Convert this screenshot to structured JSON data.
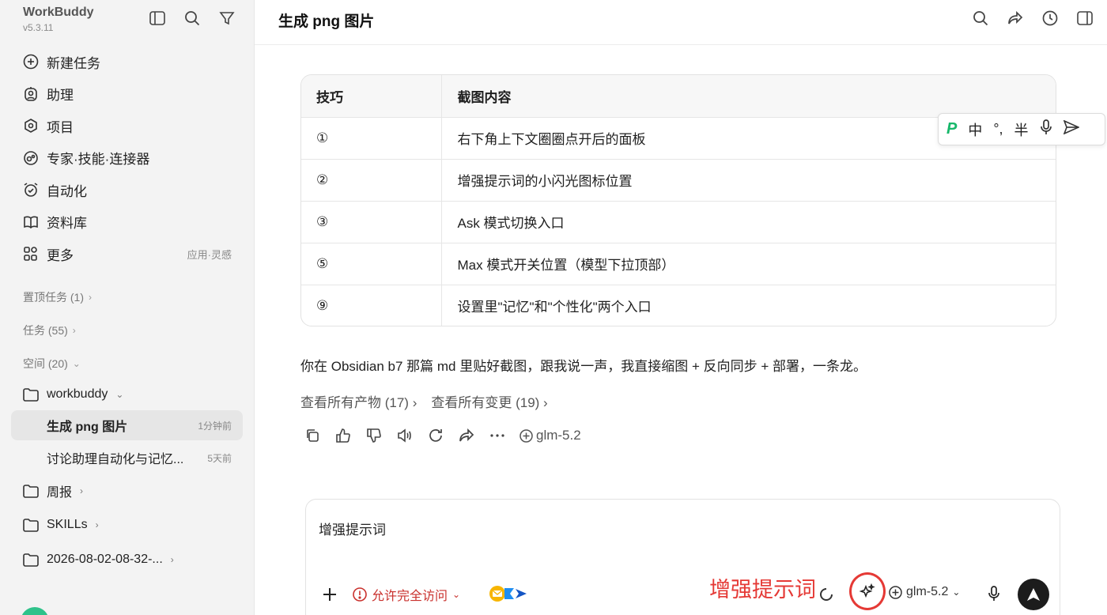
{
  "app": {
    "name": "WorkBuddy",
    "version": "v5.3.11"
  },
  "sidebar": {
    "nav": [
      {
        "label": "新建任务",
        "icon": "plus-circle-icon"
      },
      {
        "label": "助理",
        "icon": "assistant-icon"
      },
      {
        "label": "项目",
        "icon": "project-icon"
      },
      {
        "label": "专家·技能·连接器",
        "icon": "expert-icon"
      },
      {
        "label": "自动化",
        "icon": "alarm-icon"
      },
      {
        "label": "资料库",
        "icon": "book-icon"
      },
      {
        "label": "更多",
        "icon": "grid-icon",
        "meta": "应用·灵感"
      }
    ],
    "pinned": "置顶任务 (1)",
    "tasks": "任务 (55)",
    "spaces": "空间 (20)",
    "folders": [
      {
        "label": "workbuddy"
      },
      {
        "label": "周报"
      },
      {
        "label": "SKILLs"
      },
      {
        "label": "2026-08-02-08-32-..."
      }
    ],
    "task_items": [
      {
        "title": "生成 png 图片",
        "time": "1分钟前"
      },
      {
        "title": "讨论助理自动化与记忆...",
        "time": "5天前"
      }
    ]
  },
  "header": {
    "title": "生成 png 图片"
  },
  "table": {
    "headers": [
      "技巧",
      "截图内容"
    ],
    "rows": [
      [
        "①",
        "右下角上下文圈圈点开后的面板"
      ],
      [
        "②",
        "增强提示词的小闪光图标位置"
      ],
      [
        "③",
        "Ask 模式切换入口"
      ],
      [
        "⑤",
        "Max 模式开关位置（模型下拉顶部）"
      ],
      [
        "⑨",
        "设置里\"记忆\"和\"个性化\"两个入口"
      ]
    ]
  },
  "ime": {
    "lang": "中",
    "punct": "°,",
    "width": "半"
  },
  "message": "你在 Obsidian b7 那篇 md 里贴好截图，跟我说一声，我直接缩图 + 反向同步 + 部署，一条龙。",
  "links": {
    "artifacts": "查看所有产物 (17)",
    "changes": "查看所有变更 (19)"
  },
  "actions": {
    "model": "glm-5.2"
  },
  "composer": {
    "text": "增强提示词",
    "access": "允许完全访问",
    "model": "glm-5.2",
    "annotation": "增强提示词"
  }
}
